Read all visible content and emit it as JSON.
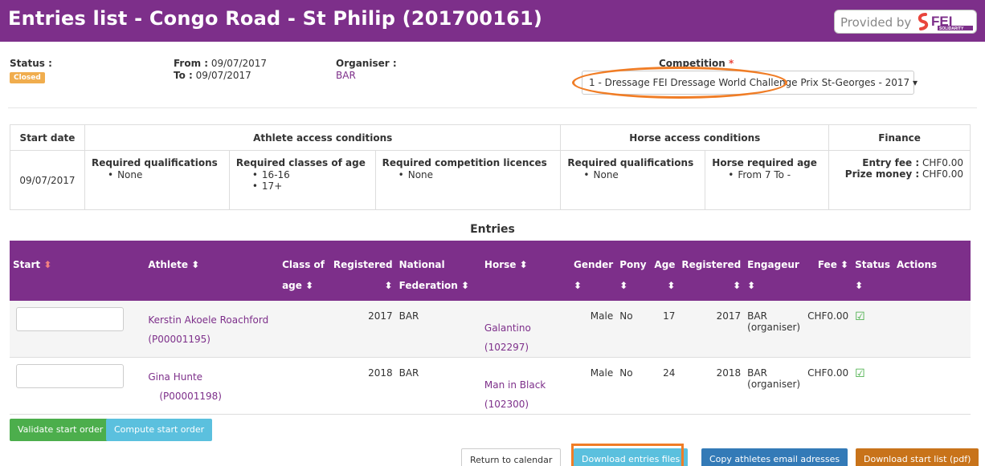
{
  "header": {
    "title": "Entries list - Congo Road - St Philip (201700161)",
    "provided_by": "Provided by",
    "logo_text": "FEI",
    "logo_subtext": "SOLIDARITY"
  },
  "info": {
    "status_label": "Status :",
    "status_value": "Closed",
    "from_label": "From :",
    "from_value": "09/07/2017",
    "to_label": "To :",
    "to_value": "09/07/2017",
    "organiser_label": "Organiser :",
    "organiser_value": "BAR",
    "competition_label": "Competition",
    "required_mark": "*",
    "competition_value": "1 - Dressage FEI Dressage World Challenge Prix St-Georges - 2017",
    "dropdown_caret": "▾"
  },
  "conditions": {
    "headers": {
      "start_date": "Start date",
      "athlete": "Athlete access conditions",
      "horse": "Horse access conditions",
      "finance": "Finance"
    },
    "start_date": "09/07/2017",
    "athlete_qual_label": "Required qualifications",
    "athlete_qual_items": [
      "None"
    ],
    "classes_label": "Required classes of age",
    "classes_items": [
      "16-16",
      "17+"
    ],
    "licences_label": "Required competition licences",
    "licences_items": [
      "None"
    ],
    "horse_qual_label": "Required qualifications",
    "horse_qual_items": [
      "None"
    ],
    "horse_age_label": "Horse required age",
    "horse_age_items": [
      "From 7 To -"
    ],
    "entry_fee_label": "Entry fee :",
    "entry_fee_value": "CHF0.00",
    "prize_label": "Prize money :",
    "prize_value": "CHF0.00"
  },
  "entries": {
    "title": "Entries",
    "sort_icon": "⬍",
    "columns": {
      "start": "Start",
      "athlete": "Athlete",
      "class_of": "Class of",
      "age": "age",
      "registered": "Registered",
      "national": "National",
      "federation": "Federation",
      "horse": "Horse",
      "gender": "Gender",
      "pony": "Pony",
      "age_col": "Age",
      "registered2": "Registered",
      "engageur": "Engageur",
      "fee": "Fee",
      "status": "Status",
      "actions": "Actions"
    },
    "rows": [
      {
        "athlete": "Kerstin Akoele Roachford",
        "athlete_id": "(P00001195)",
        "registered": "2017",
        "nf": "BAR",
        "horse": "Galantino",
        "horse_id": "(102297)",
        "gender": "Male",
        "pony": "No",
        "age": "17",
        "registered2": "2017",
        "engageur": "BAR",
        "engageur_sub": "(organiser)",
        "fee": "CHF0.00"
      },
      {
        "athlete": "Gina Hunte",
        "athlete_id": "(P00001198)",
        "registered": "2018",
        "nf": "BAR",
        "horse": "Man in Black",
        "horse_id": "(102300)",
        "gender": "Male",
        "pony": "No",
        "age": "24",
        "registered2": "2018",
        "engageur": "BAR",
        "engageur_sub": "(organiser)",
        "fee": "CHF0.00"
      }
    ]
  },
  "buttons": {
    "validate": "Validate start order",
    "compute": "Compute start order",
    "return": "Return to calendar",
    "download_entries": "Download entries files",
    "copy_emails": "Copy athletes email adresses",
    "download_start": "Download start list (pdf)"
  },
  "colors": {
    "brand": "#7d2f8a",
    "highlight": "#f07d26",
    "status_badge": "#f0ad4e"
  },
  "icons": {
    "sort": "sort-icon",
    "check": "check-square-icon",
    "caret": "caret-down-icon"
  }
}
